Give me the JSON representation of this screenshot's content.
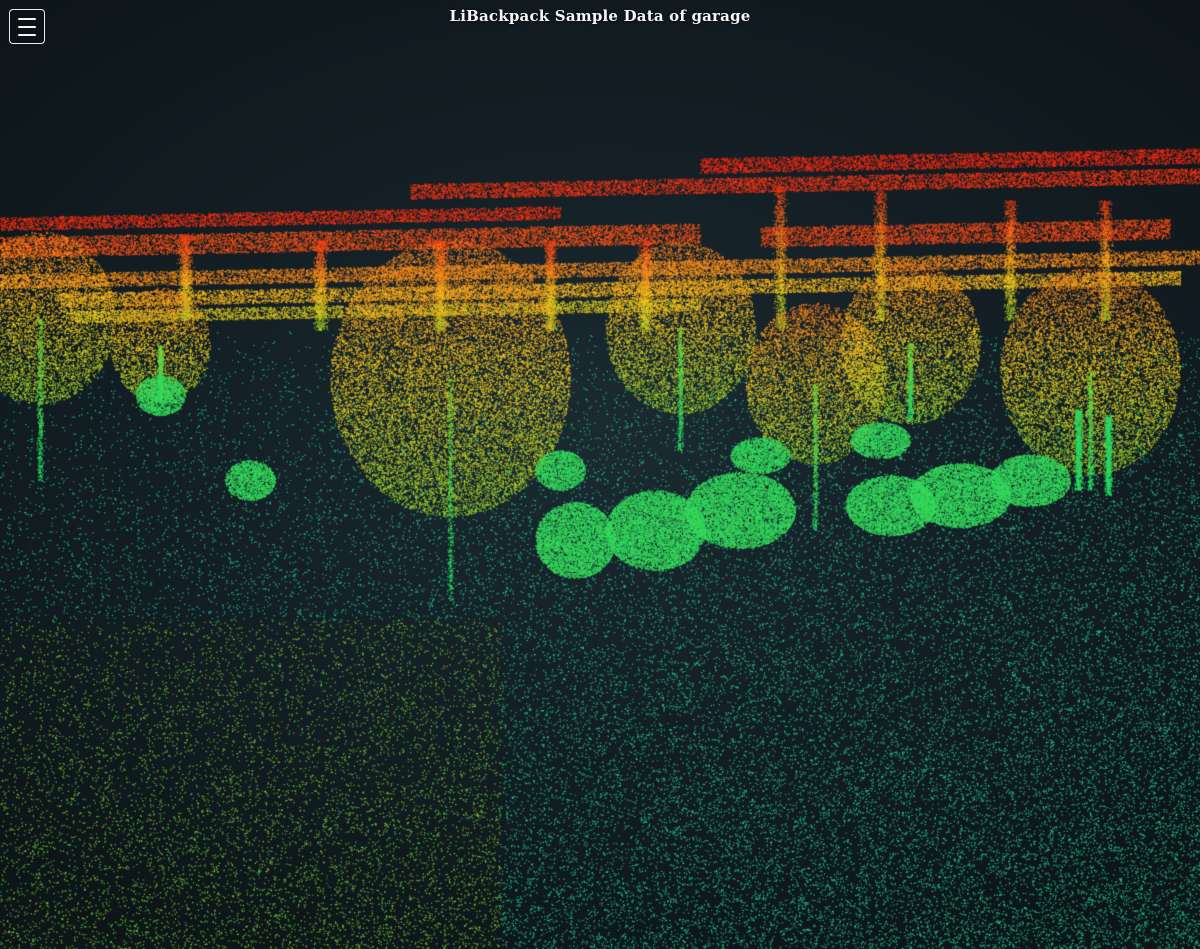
{
  "header": {
    "title": "LiBackpack Sample Data of garage"
  },
  "menu": {
    "icon": "hamburger-menu-icon"
  },
  "viewer": {
    "background_color": "#142026",
    "colormap": [
      "#ff2a12",
      "#ff8a1c",
      "#ffd21e",
      "#9bdc2a",
      "#22e06a",
      "#23e0b4"
    ]
  }
}
